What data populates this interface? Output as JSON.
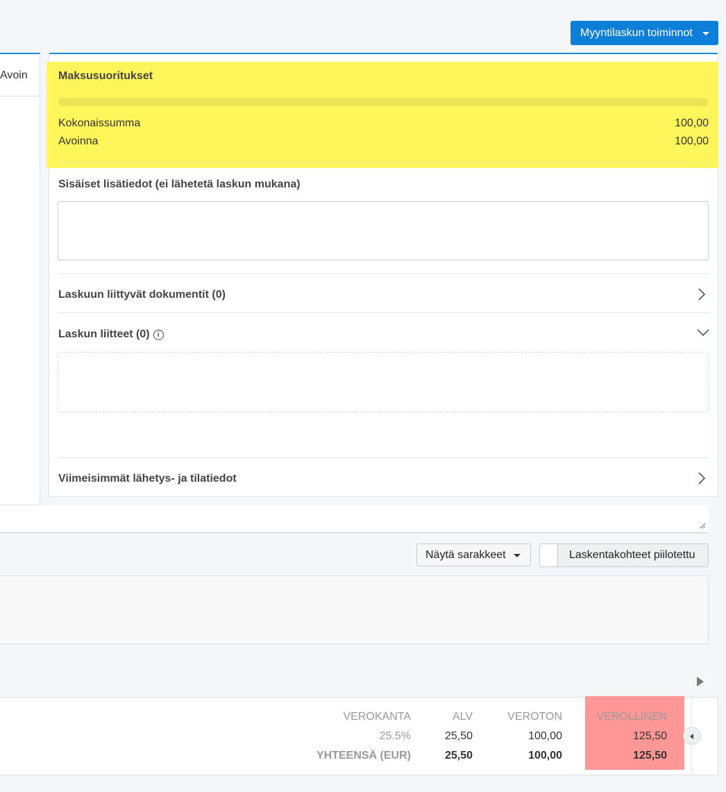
{
  "header": {
    "actions_button": "Myyntilaskun toiminnot"
  },
  "left_panel": {
    "tab_label": "Avoin"
  },
  "payments": {
    "title": "Maksusuoritukset",
    "rows": [
      {
        "label": "Kokonaissumma",
        "value": "100,00"
      },
      {
        "label": "Avoinna",
        "value": "100,00"
      }
    ]
  },
  "internal_notes": {
    "title": "Sisäiset lisätiedot (ei lähetetä laskun mukana)",
    "value": ""
  },
  "sections": {
    "documents": "Laskuun liittyvät dokumentit (0)",
    "attachments": "Laskun liitteet (0)",
    "latest": "Viimeisimmät lähetys- ja tilatiedot"
  },
  "toolbar": {
    "show_columns": "Näytä sarakkeet",
    "cost_centers_toggle": "Laskentakohteet piilotettu"
  },
  "totals": {
    "headers": [
      "VEROKANTA",
      "ALV",
      "VEROTON",
      "VEROLLINEN"
    ],
    "row": [
      "25.5%",
      "25,50",
      "100,00",
      "125,50"
    ],
    "footer": [
      "YHTEENSÄ (EUR)",
      "25,50",
      "100,00",
      "125,50"
    ]
  },
  "icons": {
    "dropdown": "caret-down-icon",
    "info": "info-icon",
    "expand": "chevron-right-icon",
    "collapse": "chevron-down-icon",
    "scroll": "arrow-right-icon"
  },
  "colors": {
    "primary": "#0d7fd9",
    "highlight_yellow": "#fff65c",
    "highlight_red": "#ff9797"
  }
}
